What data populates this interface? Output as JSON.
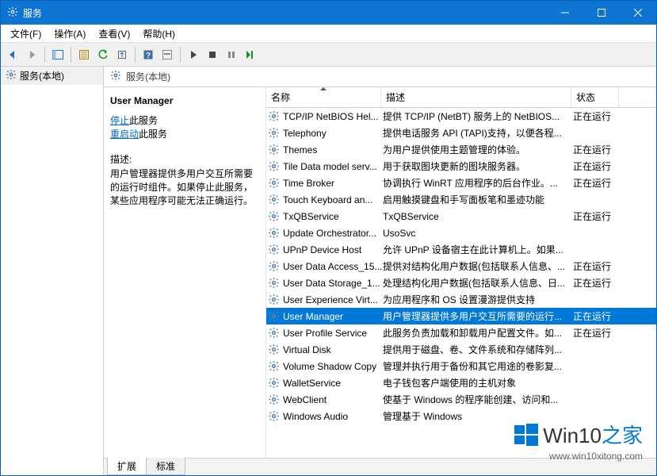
{
  "window": {
    "title": "服务"
  },
  "menubar": [
    {
      "label": "文件(F)"
    },
    {
      "label": "操作(A)"
    },
    {
      "label": "查看(V)"
    },
    {
      "label": "帮助(H)"
    }
  ],
  "nav": {
    "root": "服务(本地)"
  },
  "main": {
    "breadcrumb": "服务(本地)"
  },
  "detail": {
    "title": "User Manager",
    "link_stop": "停止",
    "link_stop_suffix": "此服务",
    "link_restart": "重启动",
    "link_restart_suffix": "此服务",
    "desc_label": "描述:",
    "desc_text": "用户管理器提供多用户交互所需要的运行时组件。如果停止此服务，某些应用程序可能无法正确运行。"
  },
  "columns": {
    "name": "名称",
    "desc": "描述",
    "status": "状态"
  },
  "services": [
    {
      "name": "TCP/IP NetBIOS Hel...",
      "desc": "提供 TCP/IP (NetBT) 服务上的 NetBIOS...",
      "status": "正在运行"
    },
    {
      "name": "Telephony",
      "desc": "提供电话服务 API (TAPI)支持，以便各程...",
      "status": ""
    },
    {
      "name": "Themes",
      "desc": "为用户提供使用主题管理的体验。",
      "status": "正在运行"
    },
    {
      "name": "Tile Data model serv...",
      "desc": "用于获取图块更新的图块服务器。",
      "status": "正在运行"
    },
    {
      "name": "Time Broker",
      "desc": "协调执行 WinRT 应用程序的后台作业。...",
      "status": "正在运行"
    },
    {
      "name": "Touch Keyboard an...",
      "desc": "启用触摸键盘和手写面板笔和墨迹功能",
      "status": ""
    },
    {
      "name": "TxQBService",
      "desc": "TxQBService",
      "status": "正在运行"
    },
    {
      "name": "Update Orchestrator...",
      "desc": "UsoSvc",
      "status": ""
    },
    {
      "name": "UPnP Device Host",
      "desc": "允许 UPnP 设备宿主在此计算机上。如果...",
      "status": ""
    },
    {
      "name": "User Data Access_15...",
      "desc": "提供对结构化用户数据(包括联系人信息、...",
      "status": "正在运行"
    },
    {
      "name": "User Data Storage_1...",
      "desc": "处理结构化用户数据(包括联系人信息、日...",
      "status": "正在运行"
    },
    {
      "name": "User Experience Virt...",
      "desc": "为应用程序和 OS 设置漫游提供支持",
      "status": ""
    },
    {
      "name": "User Manager",
      "desc": "用户管理器提供多用户交互所需要的运行...",
      "status": "正在运行",
      "selected": true
    },
    {
      "name": "User Profile Service",
      "desc": "此服务负责加载和卸载用户配置文件。如...",
      "status": "正在运行"
    },
    {
      "name": "Virtual Disk",
      "desc": "提供用于磁盘、卷、文件系统和存储阵列...",
      "status": ""
    },
    {
      "name": "Volume Shadow Copy",
      "desc": "管理并执行用于备份和其它用途的卷影复...",
      "status": ""
    },
    {
      "name": "WalletService",
      "desc": "电子钱包客户端使用的主机对象",
      "status": ""
    },
    {
      "name": "WebClient",
      "desc": "使基于 Windows 的程序能创建、访问和...",
      "status": ""
    },
    {
      "name": "Windows Audio",
      "desc": "管理基于 Windows",
      "status": ""
    }
  ],
  "tabs": [
    {
      "label": "扩展",
      "active": true
    },
    {
      "label": "标准",
      "active": false
    }
  ],
  "watermark": {
    "brand_a": "Win10",
    "brand_b": "之家",
    "url": "www.win10xitong.com"
  }
}
